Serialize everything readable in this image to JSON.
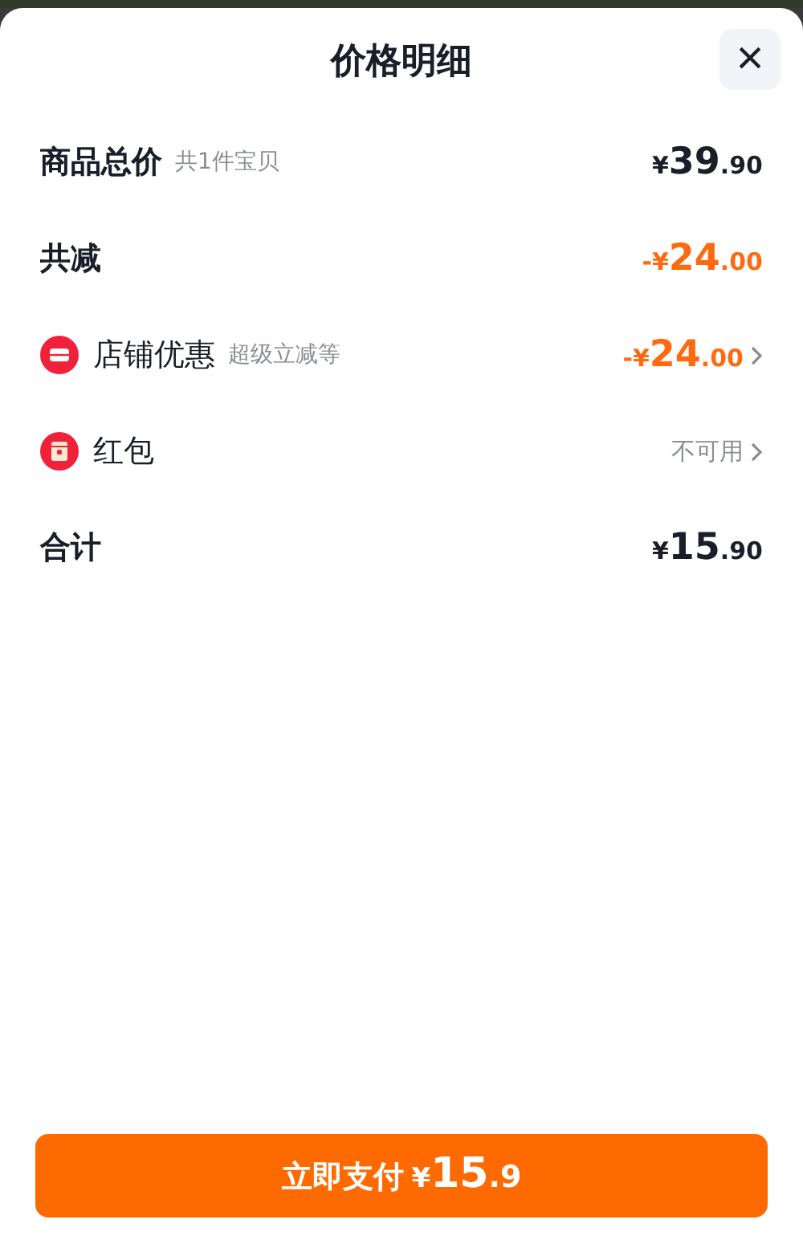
{
  "sheet": {
    "title": "价格明细",
    "close": "×"
  },
  "rows": [
    {
      "kind": "plain",
      "label": "商品总价",
      "note": "共1件宝贝",
      "value": {
        "prefix": "¥",
        "integer": "39",
        "decimal": ".90",
        "highlight": false
      },
      "link": false
    },
    {
      "kind": "plain",
      "label": "共减",
      "value": {
        "prefix": "-¥",
        "integer": "24",
        "decimal": ".00",
        "highlight": true
      },
      "link": false
    },
    {
      "kind": "shop",
      "label": "店铺优惠",
      "note": "超级立减等",
      "value": {
        "prefix": "-¥",
        "integer": "24",
        "decimal": ".00",
        "highlight": true
      },
      "link": true
    },
    {
      "kind": "packet",
      "label": "红包",
      "value": {
        "text": "不可用"
      },
      "link": true
    },
    {
      "kind": "plain",
      "label": "合计",
      "value": {
        "prefix": "¥",
        "integer": "15",
        "decimal": ".90",
        "highlight": false
      },
      "link": false
    }
  ],
  "pay_button": {
    "label": "立即支付",
    "prefix": "¥",
    "integer": "15",
    "decimal": ".9"
  }
}
